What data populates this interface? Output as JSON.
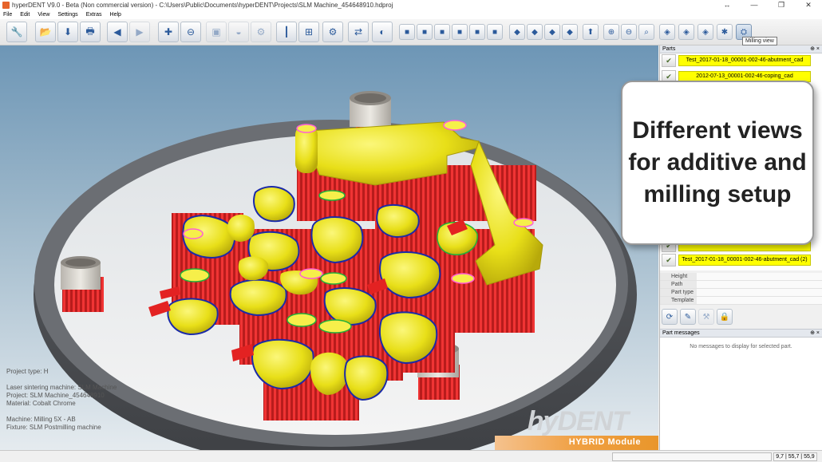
{
  "window": {
    "title": "hyperDENT V9.0 - Beta (Non commercial version) - C:\\Users\\Public\\Documents\\hyperDENT\\Projects\\SLM Machine_454648910.hdproj",
    "controls": [
      "↔",
      "—",
      "❐",
      "✕"
    ]
  },
  "menu": [
    "File",
    "Edit",
    "View",
    "Settings",
    "Extras",
    "Help"
  ],
  "toolbar": {
    "tooltip": "Milling view"
  },
  "viewport_info": {
    "project_type": "Project type: H",
    "laser": "Laser sintering machine: SLM Machine",
    "project": "Project: SLM Machine_454648910",
    "material": "Material: Cobalt Chrome",
    "machine": "Machine: Milling 5X - AB",
    "fixture": "Fixture: SLM Postmilling machine"
  },
  "brand": {
    "logo": "hyDENT",
    "module": "HYBRID Module"
  },
  "parts_panel": {
    "title": "Parts",
    "pin": "⊕ ×",
    "items": [
      {
        "label": "Test_2017-01-18_00001-002-46-abutment_cad"
      },
      {
        "label": "2012-07-13_00001-002-46-coping_cad"
      },
      {
        "label": "Test_2017-01-18_00001-002-46-abutment_cad (2)"
      }
    ]
  },
  "properties": {
    "rows": [
      {
        "key": "Height",
        "value": ""
      },
      {
        "key": "Path",
        "value": ""
      },
      {
        "key": "Part type",
        "value": ""
      },
      {
        "key": "Template",
        "value": ""
      }
    ]
  },
  "messages_panel": {
    "title": "Part messages",
    "pin": "⊕ ×",
    "empty_text": "No messages to display for selected part."
  },
  "callout": {
    "text": "Different views for additive and milling setup"
  },
  "status": {
    "coords": "9,7 | 55,7 | 55,9"
  },
  "colors": {
    "part_yellow": "#f2ec1c",
    "support_red": "#e8282a",
    "ring_grey": "#4f5155",
    "bg_top": "#6d96b6",
    "brand_orange": "#f0a043"
  }
}
